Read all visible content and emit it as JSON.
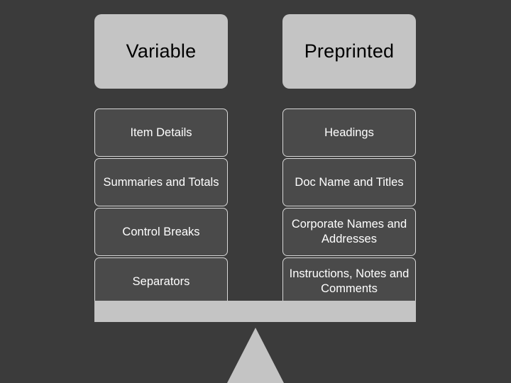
{
  "slide": {
    "background_color": "#3b3b3b",
    "columns": [
      {
        "id": "variable",
        "header": "Variable",
        "items": [
          "Item Details",
          "Summaries and Totals",
          "Control Breaks",
          "Separators"
        ]
      },
      {
        "id": "preprinted",
        "header": "Preprinted",
        "items": [
          "Headings",
          "Doc Name and Titles",
          "Corporate Names and Addresses",
          "Instructions, Notes and Comments"
        ]
      }
    ],
    "shapes": {
      "beam_label": "balance-beam",
      "fulcrum_label": "fulcrum-triangle"
    },
    "colors": {
      "header_fill": "#c4c4c4",
      "header_text": "#000000",
      "item_fill": "#4a4a4a",
      "item_border": "#d8d8d8",
      "item_text": "#ffffff",
      "beam_fill": "#c4c4c4"
    }
  }
}
